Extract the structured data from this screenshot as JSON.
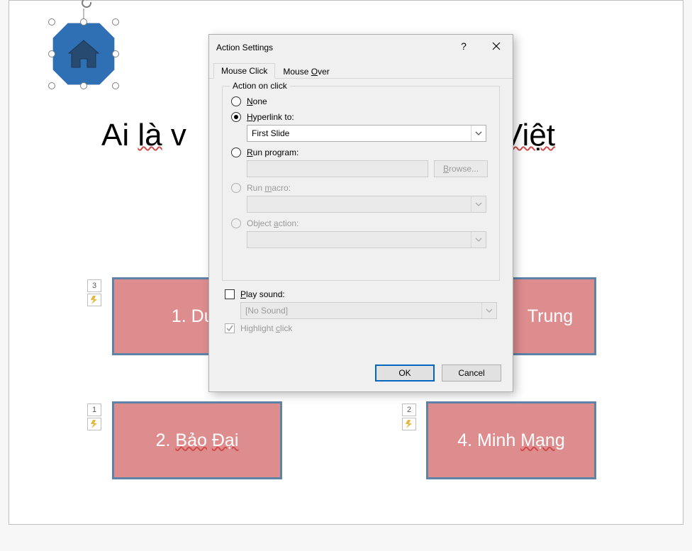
{
  "slide": {
    "title_left": "Ai ",
    "title_wavy1": "là",
    "title_mid": " v",
    "title_right_pre": " ",
    "title_wavy2": "Việt",
    "answers": {
      "a1_text": "1. Duy ",
      "a2_pre": "2. ",
      "a2_wavy": "Bảo",
      "a2_mid": " ",
      "a2_wavy2": "Đại",
      "a3_text": "Trung",
      "a4_pre": "4. Minh ",
      "a4_wavy": "Mạng"
    },
    "anim_nums": {
      "n1": "3",
      "n2": "1",
      "n3": "2"
    }
  },
  "dialog": {
    "title": "Action Settings",
    "help_aria": "?",
    "close_aria": "×",
    "tabs": {
      "mouse_click": "Mouse Click",
      "mouse_over": "Mouse Over"
    },
    "fieldset_legend": "Action on click",
    "none": "None",
    "hyperlink": "Hyperlink to:",
    "hyperlink_value": "First Slide",
    "run_program": "Run program:",
    "browse": "Browse...",
    "run_macro": "Run macro:",
    "object_action": "Object action:",
    "play_sound": "Play sound:",
    "no_sound": "[No Sound]",
    "highlight": "Highlight click",
    "ok": "OK",
    "cancel": "Cancel"
  }
}
